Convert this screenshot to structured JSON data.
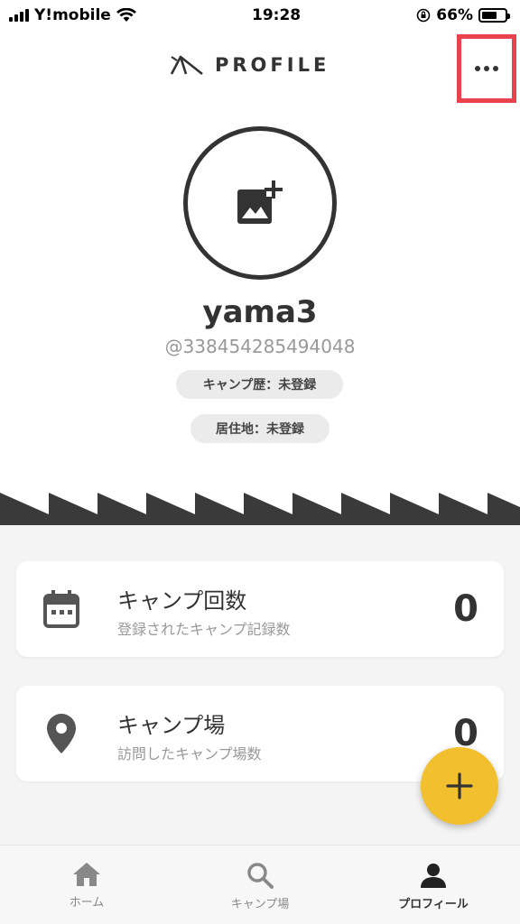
{
  "status_bar": {
    "carrier": "Y!mobile",
    "time": "19:28",
    "battery_percent": "66%",
    "battery_level": 0.66
  },
  "header": {
    "title": "PROFILE"
  },
  "profile": {
    "username": "yama3",
    "handle": "@338454285494048",
    "camp_history": "キャンプ歴：未登録",
    "residence": "居住地：未登録"
  },
  "stats": [
    {
      "title": "キャンプ回数",
      "subtitle": "登録されたキャンプ記録数",
      "value": "0",
      "icon": "calendar-icon"
    },
    {
      "title": "キャンプ場",
      "subtitle": "訪問したキャンプ場数",
      "value": "0",
      "icon": "map-pin-icon"
    }
  ],
  "tabs": [
    {
      "label": "ホーム",
      "icon": "home-icon",
      "active": false
    },
    {
      "label": "キャンプ場",
      "icon": "search-icon",
      "active": false
    },
    {
      "label": "プロフィール",
      "icon": "person-icon",
      "active": true
    }
  ],
  "colors": {
    "accent": "#f2c02e",
    "highlight": "#e8434d",
    "dark": "#333333"
  }
}
